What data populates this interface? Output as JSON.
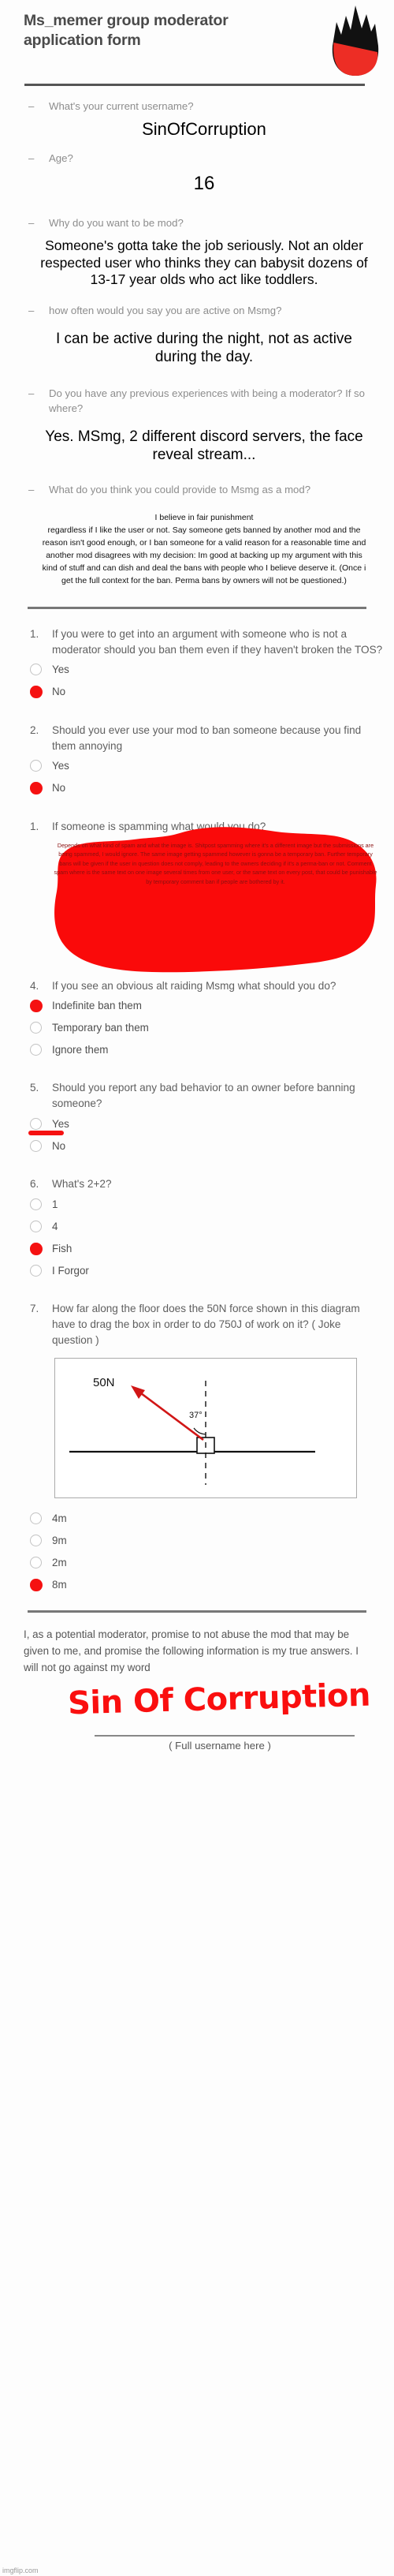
{
  "header": {
    "title": "Ms_memer group moderator application form",
    "logo": "flame-logo"
  },
  "open_questions": [
    {
      "prompt": "What's your current username?",
      "answer": "SinOfCorruption",
      "size": "large"
    },
    {
      "prompt": "Age?",
      "answer": "16",
      "size": "large"
    },
    {
      "prompt": "Why do you want to be mod?",
      "answer": "Someone's gotta take the job seriously. Not an older respected user who thinks they can babysit dozens of 13-17 year olds who act like toddlers.",
      "size": "large"
    },
    {
      "prompt": "how often would you say you are active on Msmg?",
      "answer": "I can be active during the night, not as active during the day.",
      "size": "large"
    },
    {
      "prompt": "Do you have any previous experiences with being a moderator? If so where?",
      "answer": "Yes. MSmg, 2 different discord servers, the face reveal stream...",
      "size": "large"
    },
    {
      "prompt": "What do you think you could provide to Msmg as a mod?",
      "answer_line1": "I believe in fair punishment",
      "answer": "regardless if I like the user or not. Say someone gets banned by another mod and the reason isn't good enough, or I ban someone for a valid reason for a reasonable time and another mod disagrees with my decision: Im good at backing up my argument with this kind of stuff and can dish and deal the bans with people who I believe deserve it. (Once i get the full context for the ban. Perma bans by owners will not be questioned.)",
      "size": "small"
    }
  ],
  "numbered_questions": [
    {
      "number": "1.",
      "text": "If you were to get into an argument with someone who is not a moderator should you ban them even if they haven't broken the TOS?",
      "options": [
        {
          "label": "Yes",
          "selected": false
        },
        {
          "label": "No",
          "selected": true
        }
      ]
    },
    {
      "number": "2.",
      "text": "Should you ever use your mod to ban someone because you find them annoying",
      "options": [
        {
          "label": "Yes",
          "selected": false
        },
        {
          "label": "No",
          "selected": true
        }
      ]
    },
    {
      "number": "1.",
      "text": "If someone is spamming what would you do?",
      "scribble_answer": "Depends on what kind of spam and what the image is. Shitpost spamming where it's a different image but the submissions are being spammed, I would ignore. The same image getting spammed however is gonna be a temporary ban. Further temporary bans will be given if the user in question does not comply, leading to the owners deciding if it's a perma-ban or not. Comment spam where is the same text on one image several times from one user, or the same text on every post, that could be punishable by temporary comment ban if people are bothered by it.",
      "options": []
    },
    {
      "number": "4.",
      "text": "If you see an obvious alt raiding Msmg what should you do?",
      "options": [
        {
          "label": "Indefinite ban them",
          "selected": true
        },
        {
          "label": "Temporary ban them",
          "selected": false
        },
        {
          "label": "Ignore them",
          "selected": false
        }
      ]
    },
    {
      "number": "5.",
      "text": "Should you report any bad behavior to an owner before banning someone?",
      "options": [
        {
          "label": "Yes",
          "selected": false
        },
        {
          "label": "No",
          "selected": false
        }
      ],
      "red_strike_after_option": 0
    },
    {
      "number": "6.",
      "text": "What's 2+2?",
      "options": [
        {
          "label": "1",
          "selected": false
        },
        {
          "label": "4",
          "selected": false
        },
        {
          "label": "Fish",
          "selected": true
        },
        {
          "label": "I Forgor",
          "selected": false
        }
      ]
    },
    {
      "number": "7.",
      "text": "How far along the floor does the 50N force shown in this diagram have to drag the box in order to do 750J of work on it? ( Joke question )",
      "diagram": {
        "force_label": "50N",
        "angle_label": "37°"
      },
      "options": [
        {
          "label": "4m",
          "selected": false
        },
        {
          "label": "9m",
          "selected": false
        },
        {
          "label": "2m",
          "selected": false
        },
        {
          "label": "8m",
          "selected": true
        }
      ]
    }
  ],
  "footer": {
    "pledge": "I, as a potential moderator, promise to not abuse the mod that may be given to me, and promise the following information is my true answers. I will not go against my word",
    "signature": "Sin Of Corruption",
    "signature_caption": "( Full username here )",
    "watermark": "imgflip.com"
  },
  "colors": {
    "red": "#f51111",
    "muted": "#8d8d8d",
    "text": "#4f4f4f"
  }
}
